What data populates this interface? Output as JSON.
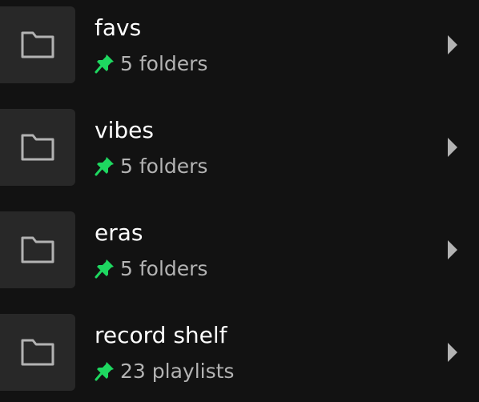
{
  "colors": {
    "background": "#121212",
    "thumbnail": "#282828",
    "title": "#ffffff",
    "subtitle": "#b3b3b3",
    "pin": "#1ed760",
    "chevron": "#b3b3b3"
  },
  "icons": {
    "thumbnail": "folder-icon",
    "pinned": "pin-icon",
    "open": "chevron-right-icon"
  },
  "items": [
    {
      "title": "favs",
      "subtitle": "5 folders"
    },
    {
      "title": "vibes",
      "subtitle": "5 folders"
    },
    {
      "title": "eras",
      "subtitle": "5 folders"
    },
    {
      "title": "record shelf",
      "subtitle": "23 playlists"
    }
  ]
}
